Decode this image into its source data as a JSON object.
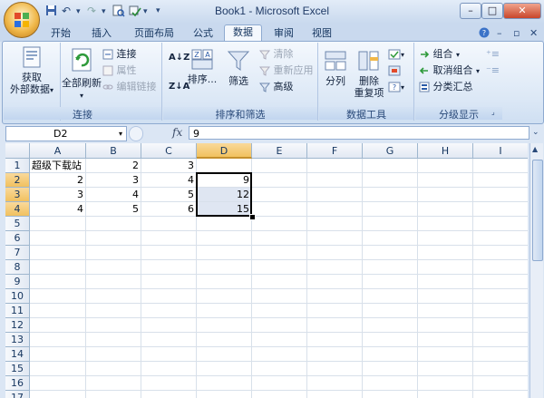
{
  "window": {
    "title": "Book1 - Microsoft Excel",
    "buttons": {
      "minimize": "–",
      "restore": "□",
      "close": "✕"
    }
  },
  "quick_access": {
    "save": "💾",
    "undo": "↶",
    "redo": "↷",
    "print_preview": "🔍",
    "customize": "▾"
  },
  "tabs": [
    "开始",
    "插入",
    "页面布局",
    "公式",
    "数据",
    "审阅",
    "视图"
  ],
  "active_tab": "数据",
  "ribbon": {
    "get_external": {
      "label_line1": "获取",
      "label_line2": "外部数据"
    },
    "refresh_all": {
      "label": "全部刷新"
    },
    "connections": {
      "label": "连接",
      "properties": "属性",
      "edit_links": "编辑链接"
    },
    "sort_az": "A↓Z",
    "sort_za": "Z↓A",
    "sort": "排序...",
    "filter": "筛选",
    "clear": "清除",
    "reapply": "重新应用",
    "advanced": "高级",
    "text_to_columns": "分列",
    "remove_duplicates": {
      "line1": "删除",
      "line2": "重复项"
    },
    "group": "组合",
    "ungroup": "取消组合",
    "subtotal": "分类汇总",
    "group_labels": [
      "连接",
      "排序和筛选",
      "数据工具",
      "分级显示"
    ]
  },
  "formula_bar": {
    "name_box": "D2",
    "fx": "fx",
    "value": "9"
  },
  "sheet": {
    "columns": [
      "A",
      "B",
      "C",
      "D",
      "E",
      "F",
      "G",
      "H",
      "I"
    ],
    "rows": [
      "1",
      "2",
      "3",
      "4",
      "5",
      "6",
      "7",
      "8",
      "9",
      "10",
      "11",
      "12",
      "13",
      "14",
      "15",
      "16",
      "17"
    ],
    "cells": [
      {
        "ref": "A1",
        "value": "超级下载站",
        "numeric": false
      },
      {
        "ref": "B1",
        "value": "2",
        "numeric": true
      },
      {
        "ref": "C1",
        "value": "3",
        "numeric": true
      },
      {
        "ref": "A2",
        "value": "2",
        "numeric": true
      },
      {
        "ref": "B2",
        "value": "3",
        "numeric": true
      },
      {
        "ref": "C2",
        "value": "4",
        "numeric": true
      },
      {
        "ref": "D2",
        "value": "9",
        "numeric": true
      },
      {
        "ref": "A3",
        "value": "3",
        "numeric": true
      },
      {
        "ref": "B3",
        "value": "4",
        "numeric": true
      },
      {
        "ref": "C3",
        "value": "5",
        "numeric": true
      },
      {
        "ref": "D3",
        "value": "12",
        "numeric": true
      },
      {
        "ref": "A4",
        "value": "4",
        "numeric": true
      },
      {
        "ref": "B4",
        "value": "5",
        "numeric": true
      },
      {
        "ref": "C4",
        "value": "6",
        "numeric": true
      },
      {
        "ref": "D4",
        "value": "15",
        "numeric": true
      }
    ],
    "selected_range": "D2:D4",
    "active_cell": "D2"
  }
}
